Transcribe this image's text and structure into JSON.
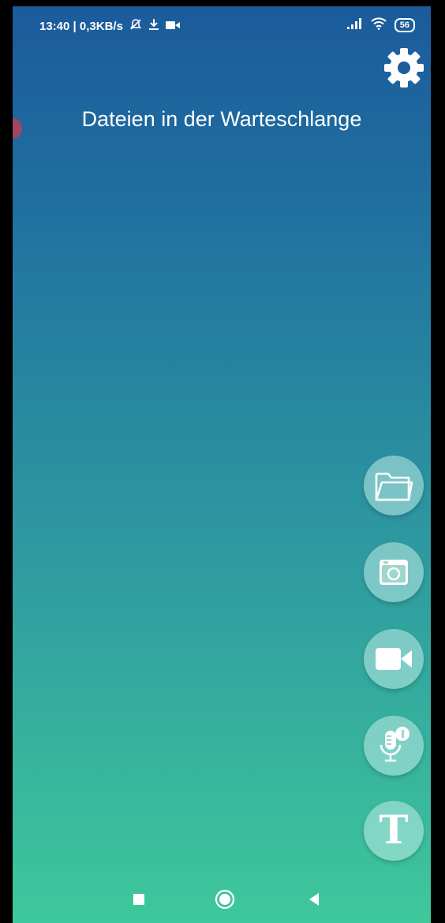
{
  "status_bar": {
    "time_info": "13:40 | 0,3KB/s",
    "battery": "56"
  },
  "queue": {
    "title": "Dateien in der Warteschlange"
  },
  "icons": {
    "settings": "gear-icon",
    "folder": "folder-icon",
    "camera": "camera-icon",
    "video": "video-camera-icon",
    "mic": "microphone-icon",
    "text": "T"
  },
  "colors": {
    "gradient_top": "#1b5b9c",
    "gradient_bottom": "#3fc89b",
    "fab_fill": "#bfebe6"
  }
}
